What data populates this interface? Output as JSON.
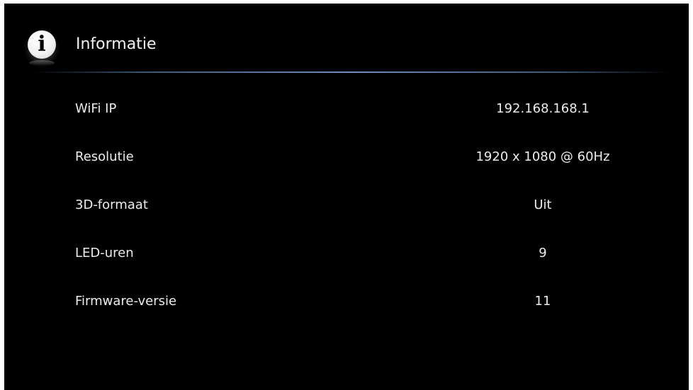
{
  "header": {
    "icon": "info-icon",
    "icon_glyph": "i",
    "title": "Informatie"
  },
  "colors": {
    "background": "#000000",
    "text": "#ececec",
    "divider": "#6d8fb5"
  },
  "info": {
    "rows": [
      {
        "label": "WiFi IP",
        "value": "192.168.168.1"
      },
      {
        "label": "Resolutie",
        "value": "1920 x 1080 @ 60Hz"
      },
      {
        "label": "3D-formaat",
        "value": "Uit"
      },
      {
        "label": "LED-uren",
        "value": "9"
      },
      {
        "label": "Firmware-versie",
        "value": "11"
      }
    ]
  }
}
